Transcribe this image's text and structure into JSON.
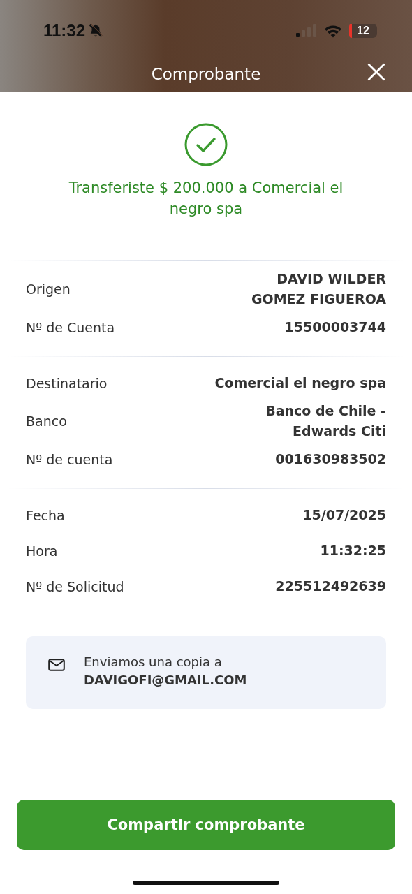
{
  "status_bar": {
    "time": "11:32",
    "battery": "12"
  },
  "header": {
    "title": "Comprobante"
  },
  "success": {
    "message": "Transferiste $ 200.000 a Comercial el negro spa"
  },
  "sections": [
    {
      "rows": [
        {
          "label": "Origen",
          "value": [
            "DAVID WILDER",
            "GOMEZ FIGUEROA"
          ]
        },
        {
          "label": "Nº de Cuenta",
          "value": [
            "15500003744"
          ]
        }
      ]
    },
    {
      "rows": [
        {
          "label": "Destinatario",
          "value": [
            "Comercial el negro spa"
          ]
        },
        {
          "label": "Banco",
          "value": [
            "Banco de Chile -",
            "Edwards Citi"
          ]
        },
        {
          "label": "Nº de cuenta",
          "value": [
            "001630983502"
          ]
        }
      ]
    },
    {
      "rows": [
        {
          "label": "Fecha",
          "value": [
            "15/07/2025"
          ]
        },
        {
          "label": "Hora",
          "value": [
            "11:32:25"
          ]
        },
        {
          "label": "Nº de Solicitud",
          "value": [
            "225512492639"
          ]
        }
      ]
    }
  ],
  "email_note": {
    "text": "Enviamos una copia a **DAVIGOFI@GMAIL.COM**"
  },
  "share_button": {
    "label": "Compartir comprobante"
  }
}
